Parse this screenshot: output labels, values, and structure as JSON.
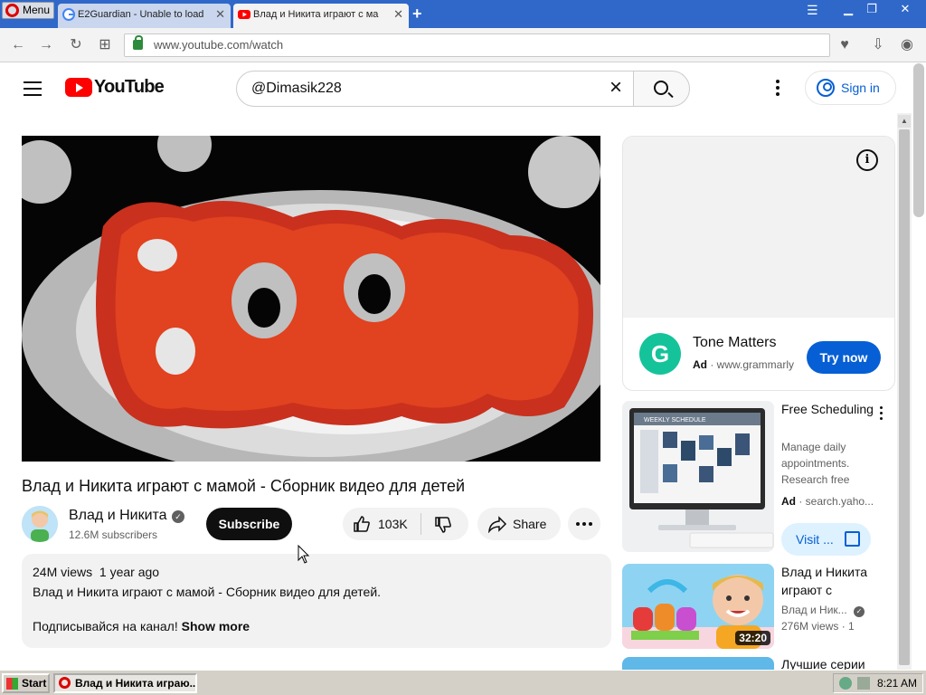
{
  "browser": {
    "menu_label": "Menu",
    "tabs": [
      {
        "title": "E2Guardian - Unable to load"
      },
      {
        "title": "Влад и Никита играют с ма"
      }
    ],
    "url": "www.youtube.com/watch"
  },
  "youtube": {
    "logo_text": "YouTube",
    "search_value": "@Dimasik228",
    "signin_label": "Sign in"
  },
  "video": {
    "title": "Влад и Никита играют с мамой - Сборник видео для детей",
    "channel_name": "Влад и Никита",
    "subscribers": "12.6M subscribers",
    "subscribe_label": "Subscribe",
    "likes": "103K",
    "share_label": "Share",
    "views": "24M views",
    "age": "1 year ago",
    "description_line1": "Влад и Никита играют с мамой - Сборник видео для детей.",
    "description_line2": "Подписывайся на канал!",
    "show_more": "Show more"
  },
  "sidebar": {
    "ad": {
      "brand_letter": "G",
      "title": "Tone Matters",
      "ad_badge": "Ad",
      "domain": "www.grammarly",
      "cta": "Try now"
    },
    "items": [
      {
        "title": "Free Scheduling",
        "meta1": "Manage daily appointments. Research free",
        "ad_badge": "Ad",
        "domain": "search.yaho...",
        "cta": "Visit ...",
        "thumb_text": "WEEKLY SCHEDULE"
      },
      {
        "title": "Влад и Никита играют с",
        "channel": "Влад и Ник...",
        "views": "276M views",
        "extra": "1",
        "duration": "32:20"
      },
      {
        "title": "Лучшие серии"
      }
    ]
  },
  "taskbar": {
    "start_label": "Start",
    "task_label": "Влад и Никита играю...",
    "clock": "8:21 AM"
  }
}
